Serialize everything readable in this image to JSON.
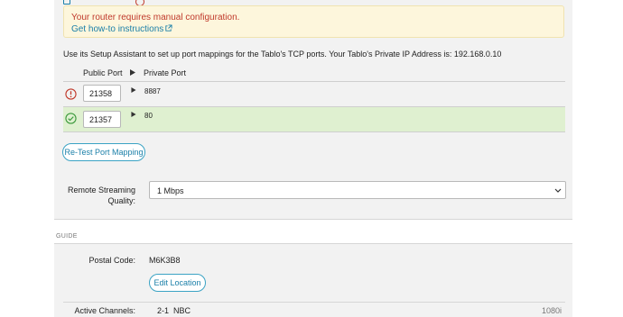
{
  "alert": {
    "message": "Your router requires manual configuration.",
    "link_label": "Get how-to instructions"
  },
  "intro_text": "Use its Setup Assistant to set up port mappings for the Tablo's TCP ports. Your Tablo's Private IP Address is: 192.168.0.10",
  "port_table": {
    "headers": {
      "public": "Public Port",
      "private": "Private Port"
    },
    "rows": [
      {
        "status": "error",
        "public_port": "21358",
        "private_port": "8887"
      },
      {
        "status": "ok",
        "public_port": "21357",
        "private_port": "80"
      }
    ]
  },
  "retest_button": "Re-Test Port Mapping",
  "streaming": {
    "label_line1": "Remote Streaming",
    "label_line2": "Quality:",
    "selected": "1 Mbps"
  },
  "guide": {
    "section_title": "GUIDE",
    "postal_label": "Postal Code:",
    "postal_value": "M6K3B8",
    "edit_location_button": "Edit Location",
    "channels_label": "Active Channels:",
    "channel_number": "2-1",
    "channel_name": "NBC",
    "channel_quality": "1080i"
  },
  "colors": {
    "accent": "#1a7fa8",
    "error": "#c0392b",
    "success": "#3c9a3c",
    "alert_bg": "#fdf6dc",
    "ok_row_bg": "#dff0d0",
    "panel_bg": "#f2f2f2"
  },
  "icons": {
    "error_status": "exclamation-circle-icon",
    "ok_status": "check-circle-icon",
    "external_link": "external-link-icon",
    "column_arrow": "play-triangle-icon",
    "dropdown": "chevron-down-icon"
  }
}
